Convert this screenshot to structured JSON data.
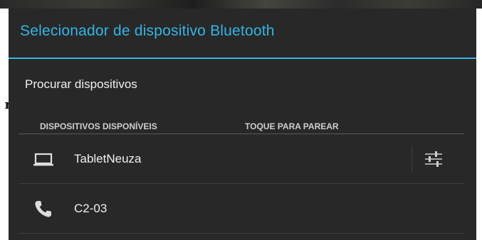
{
  "background_peek": {
    "partial_letter": "r"
  },
  "dialog": {
    "title": "Selecionador de dispositivo Bluetooth",
    "scan_action": "Procurar dispositivos",
    "section_header": {
      "available_label": "DISPOSITIVOS DISPONÍVEIS",
      "hint_label": "TOQUE PARA PAREAR"
    },
    "devices": [
      {
        "name": "TabletNeuza",
        "icon": "laptop-icon",
        "has_settings": true
      },
      {
        "name": "C2-03",
        "icon": "phone-icon",
        "has_settings": false
      }
    ]
  },
  "colors": {
    "accent": "#33b5e5",
    "dialog_bg": "#282828",
    "text": "#f0f0f0",
    "divider": "#3e3e3e"
  }
}
